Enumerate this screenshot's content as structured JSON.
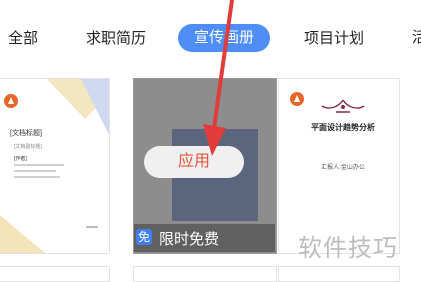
{
  "tabs": [
    {
      "label": "全部"
    },
    {
      "label": "求职简历"
    },
    {
      "label": "宣传画册",
      "active": true
    },
    {
      "label": "项目计划"
    },
    {
      "label": "活"
    }
  ],
  "cards": [
    {
      "doc_title": "[文档标题]",
      "lines": [
        "[文档副标题]",
        "[作者]"
      ]
    },
    {
      "apply_label": "应用",
      "free_badge": "免",
      "free_label": "限时免费"
    },
    {
      "doc_title": "平面设计趋势分析",
      "subtitle": "汇报人:金山办公"
    }
  ],
  "watermark": "软件技巧",
  "colors": {
    "accent": "#4f8ef7",
    "apply_text": "#e8553e",
    "arrow": "#e23b3b",
    "logo": "#e8662a"
  }
}
